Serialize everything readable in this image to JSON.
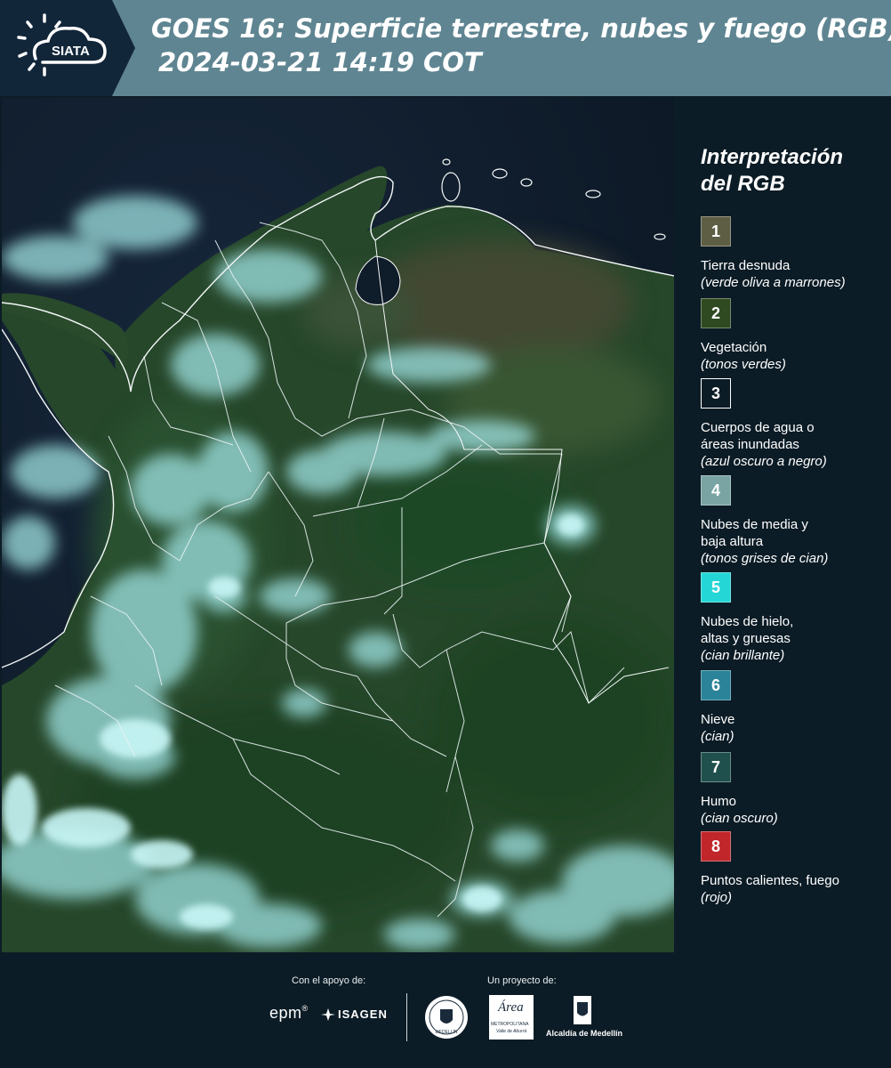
{
  "header": {
    "logo_text": "SIATA",
    "title": "GOES 16: Superficie terrestre, nubes y fuego (RGB)",
    "timestamp": "2024-03-21 14:19 COT"
  },
  "legend": {
    "title_line1": "Interpretación",
    "title_line2": "del RGB",
    "items": [
      {
        "number": "1",
        "color": "#5e5e44",
        "label_lines": [
          "Tierra desnuda"
        ],
        "sub": "(verde oliva a marrones)"
      },
      {
        "number": "2",
        "color": "#2f4a20",
        "label_lines": [
          "Vegetación"
        ],
        "sub": "(tonos verdes)"
      },
      {
        "number": "3",
        "color": "#0c1c26",
        "label_lines": [
          "Cuerpos de agua o",
          "áreas inundadas"
        ],
        "sub": "(azul oscuro a negro)"
      },
      {
        "number": "4",
        "color": "#7aa4a4",
        "label_lines": [
          "Nubes de media y",
          "baja altura"
        ],
        "sub": "(tonos grises de cian)"
      },
      {
        "number": "5",
        "color": "#25d6d6",
        "label_lines": [
          "Nubes de hielo,",
          "altas y gruesas"
        ],
        "sub": "(cian brillante)"
      },
      {
        "number": "6",
        "color": "#2a8398",
        "label_lines": [
          "Nieve"
        ],
        "sub": "(cian)"
      },
      {
        "number": "7",
        "color": "#20504e",
        "label_lines": [
          "Humo"
        ],
        "sub": "(cian oscuro)"
      },
      {
        "number": "8",
        "color": "#c0262a",
        "label_lines": [
          "Puntos calientes, fuego"
        ],
        "sub": "(rojo)"
      }
    ]
  },
  "footer": {
    "support_caption": "Con el apoyo de:",
    "project_caption": "Un proyecto de:",
    "sponsor1": "epm",
    "sponsor2": "ISAGEN",
    "partner1_caption": "MEDELLÍN",
    "partner2_name": "Área",
    "partner2_line": "METROPOLITANA",
    "partner2_sub": "Valle de Aburrá",
    "partner3": "Alcaldía de Medellín"
  }
}
